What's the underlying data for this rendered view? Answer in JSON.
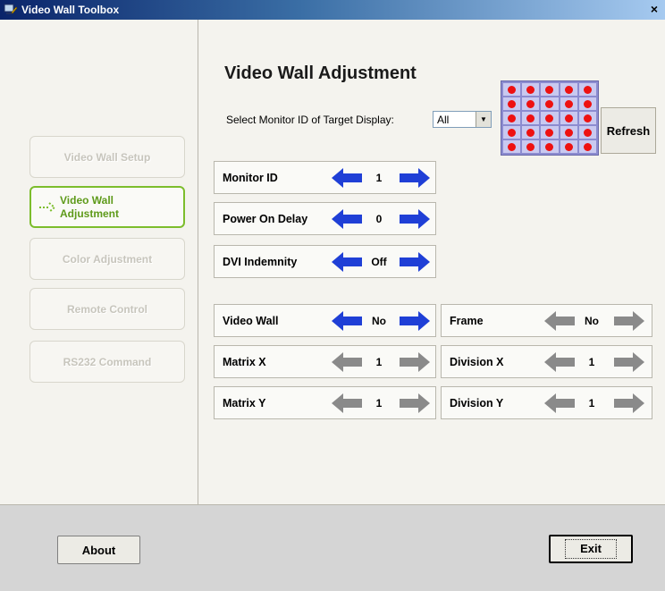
{
  "window": {
    "title": "Video Wall Toolbox",
    "close_glyph": "×"
  },
  "sidebar": {
    "items": [
      {
        "label": "Video Wall Setup",
        "active": false
      },
      {
        "label_line1": "Video Wall",
        "label_line2": "Adjustment",
        "active": true
      },
      {
        "label": "Color Adjustment",
        "active": false
      },
      {
        "label": "Remote Control",
        "active": false
      },
      {
        "label": "RS232 Command",
        "active": false
      }
    ]
  },
  "main": {
    "title": "Video Wall Adjustment",
    "select_label": "Select Monitor ID of Target Display:",
    "select_value": "All",
    "refresh_label": "Refresh",
    "monitor_grid": {
      "rows": 5,
      "cols": 5
    },
    "settings": [
      {
        "label": "Monitor ID",
        "value": "1",
        "enabled": true
      },
      {
        "label": "Power On Delay",
        "value": "0",
        "enabled": true
      },
      {
        "label": "DVI Indemnity",
        "value": "Off",
        "enabled": true
      }
    ],
    "tiling_left": [
      {
        "label": "Video Wall",
        "value": "No",
        "enabled": true
      },
      {
        "label": "Matrix X",
        "value": "1",
        "enabled": false
      },
      {
        "label": "Matrix Y",
        "value": "1",
        "enabled": false
      }
    ],
    "tiling_right": [
      {
        "label": "Frame",
        "value": "No",
        "enabled": false
      },
      {
        "label": "Division X",
        "value": "1",
        "enabled": false
      },
      {
        "label": "Division Y",
        "value": "1",
        "enabled": false
      }
    ]
  },
  "footer": {
    "about_label": "About",
    "exit_label": "Exit"
  },
  "colors": {
    "arrow_enabled": "#1f3fd6",
    "arrow_disabled": "#8a8a8a",
    "active_green": "#7cbd2c",
    "grid_dot": "#ee1111"
  }
}
